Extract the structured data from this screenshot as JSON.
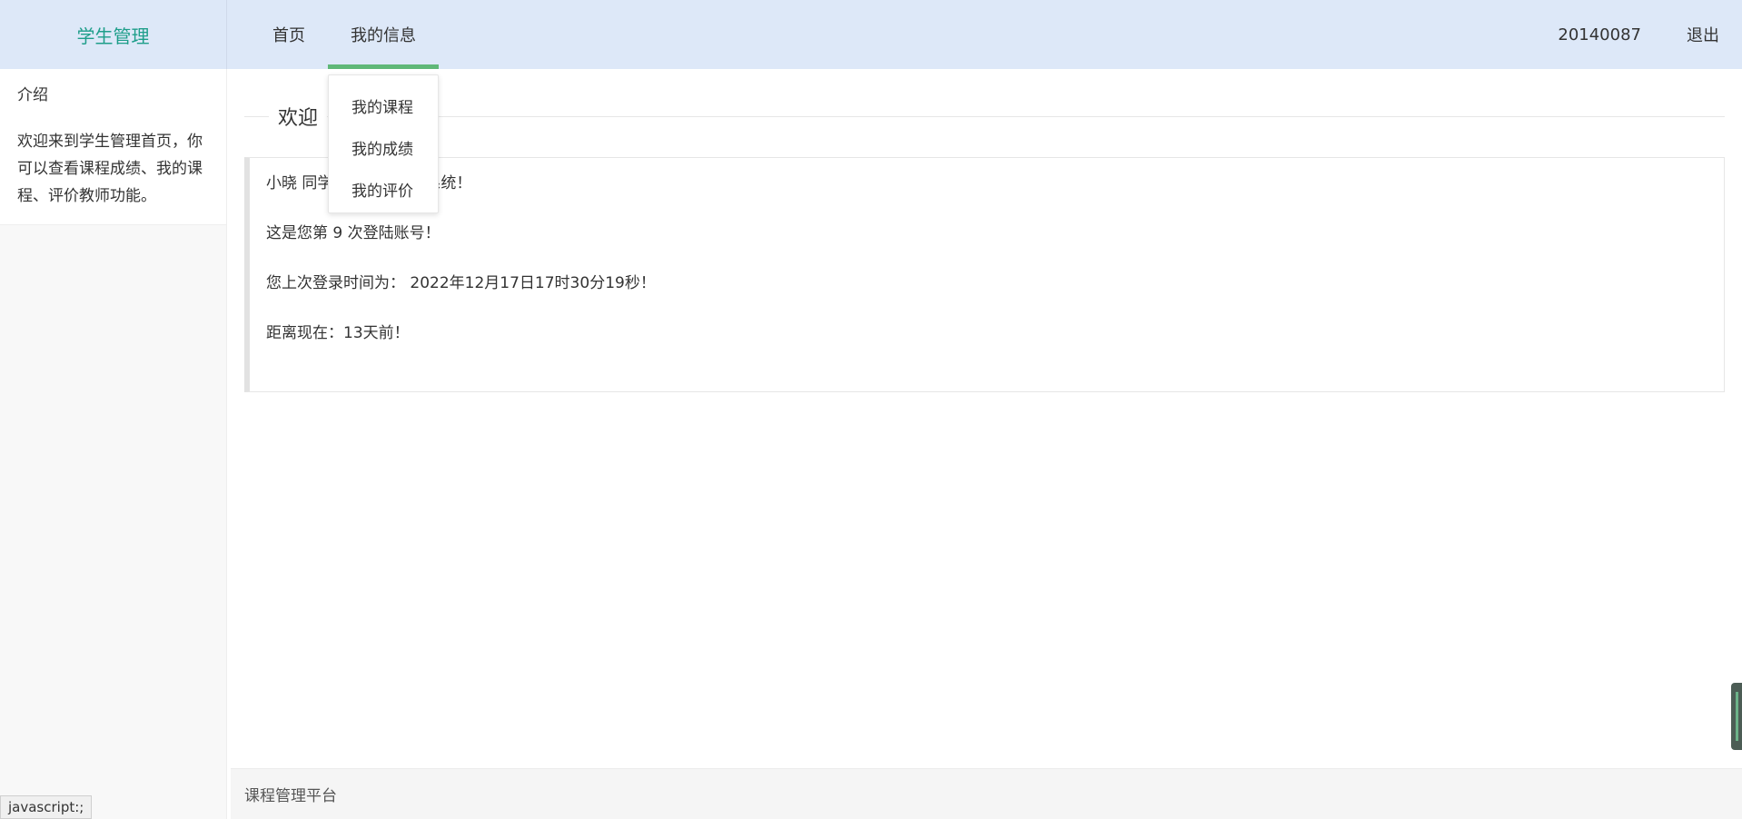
{
  "app": {
    "brand": "学生管理"
  },
  "nav": {
    "items": [
      {
        "label": "首页"
      },
      {
        "label": "我的信息"
      }
    ],
    "user_id": "20140087",
    "logout": "退出"
  },
  "dropdown": {
    "items": [
      {
        "label": "我的课程"
      },
      {
        "label": "我的成绩"
      },
      {
        "label": "我的评价"
      }
    ]
  },
  "sidebar": {
    "title": "介绍",
    "text": "欢迎来到学生管理首页，你可以查看课程成绩、我的课程、评价教师功能。"
  },
  "main": {
    "legend": "欢迎",
    "lines": [
      "小晓 同学，欢迎您登陆系统！",
      "这是您第 9 次登陆账号！",
      "您上次登录时间为： 2022年12月17日17时30分19秒！",
      "距离现在：13天前！"
    ]
  },
  "footer": {
    "text": "课程管理平台"
  },
  "statusbar": {
    "text": "javascript:;"
  },
  "colors": {
    "header_bg": "#dde8f8",
    "brand": "#1e9e8a",
    "nav_active_underline": "#5fb878"
  }
}
